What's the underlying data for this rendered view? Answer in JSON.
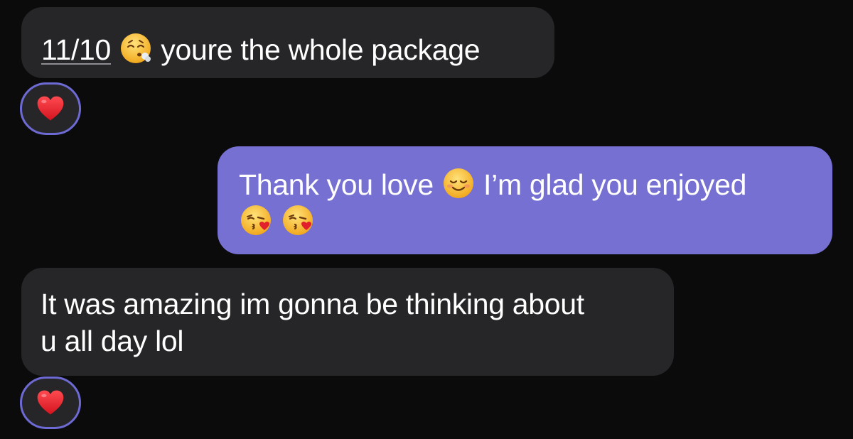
{
  "messages": [
    {
      "direction": "incoming",
      "score": "11/10",
      "emoji": "face-exhaling",
      "text": "youre the whole package",
      "reaction": "red-heart"
    },
    {
      "direction": "outgoing",
      "line1": "Thank you love",
      "emoji1": "smiling-face",
      "line1_rest": "I’m glad you enjoyed",
      "emojis_line2": [
        "face-blowing-kiss",
        "face-blowing-kiss"
      ]
    },
    {
      "direction": "incoming",
      "line1": "It was amazing im gonna be thinking about",
      "line2": "u all day lol",
      "reaction": "red-heart"
    }
  ],
  "colors": {
    "background": "#0b0b0c",
    "incoming_bubble": "#262628",
    "outgoing_bubble": "#7570d1",
    "reaction_border": "#6e6ad4",
    "heart": "#e2202c"
  }
}
